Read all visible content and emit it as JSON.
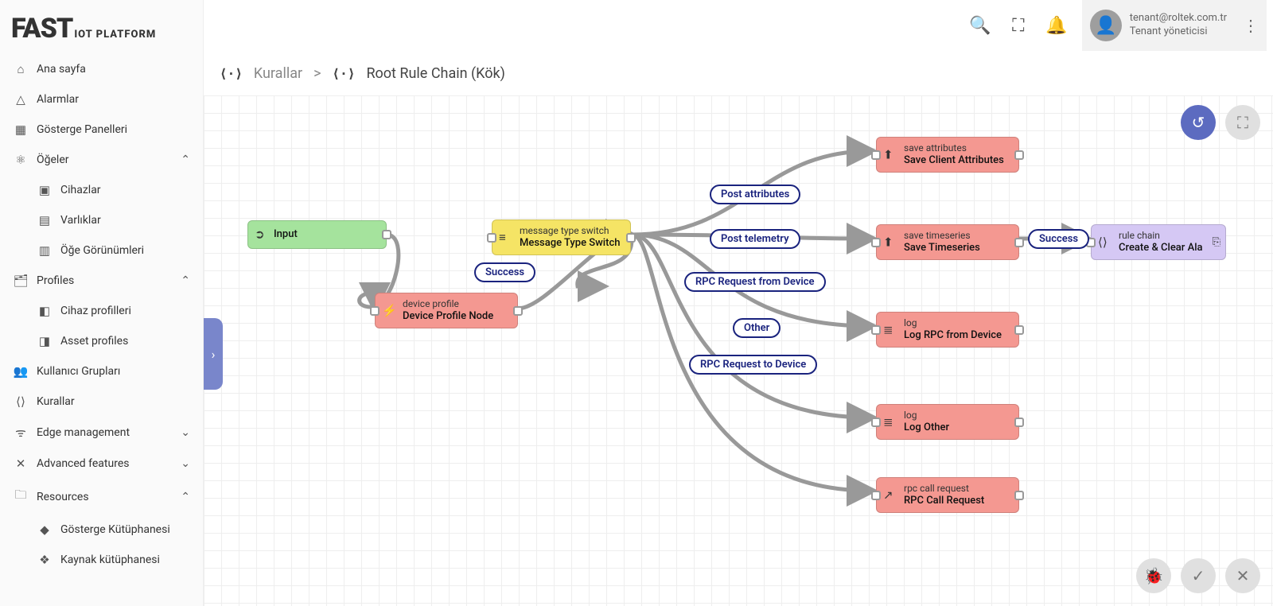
{
  "logo": {
    "big": "FAST",
    "small": "IOT PLATFORM"
  },
  "nav": {
    "home": "Ana sayfa",
    "alarms": "Alarmlar",
    "dashboards": "Gösterge Panelleri",
    "items": "Öğeler",
    "devices": "Cihazlar",
    "assets": "Varlıklar",
    "views": "Öğe Görünümleri",
    "profiles": "Profiles",
    "device_profiles": "Cihaz profilleri",
    "asset_profiles": "Asset profiles",
    "user_groups": "Kullanıcı Grupları",
    "rules": "Kurallar",
    "edge": "Edge management",
    "advanced": "Advanced features",
    "resources": "Resources",
    "widget_lib": "Gösterge Kütüphanesi",
    "resource_lib": "Kaynak kütüphanesi"
  },
  "user": {
    "email": "tenant@roltek.com.tr",
    "role": "Tenant yöneticisi"
  },
  "breadcrumb": {
    "root": "Kurallar",
    "current": "Root Rule Chain (Kök)"
  },
  "nodes": {
    "input": {
      "name": "Input"
    },
    "device_profile": {
      "type": "device profile",
      "name": "Device Profile Node"
    },
    "switch": {
      "type": "message type switch",
      "name": "Message Type Switch"
    },
    "save_attr": {
      "type": "save attributes",
      "name": "Save Client Attributes"
    },
    "save_ts": {
      "type": "save timeseries",
      "name": "Save Timeseries"
    },
    "log_rpc": {
      "type": "log",
      "name": "Log RPC from Device"
    },
    "log_other": {
      "type": "log",
      "name": "Log Other"
    },
    "rpc_call": {
      "type": "rpc call request",
      "name": "RPC Call Request"
    },
    "rule_chain": {
      "type": "rule chain",
      "name": "Create & Clear Alarm"
    }
  },
  "edges": {
    "success1": "Success",
    "success2": "Success",
    "post_attr": "Post attributes",
    "post_tel": "Post telemetry",
    "rpc_from": "RPC Request from Device",
    "other": "Other",
    "rpc_to": "RPC Request to Device"
  }
}
